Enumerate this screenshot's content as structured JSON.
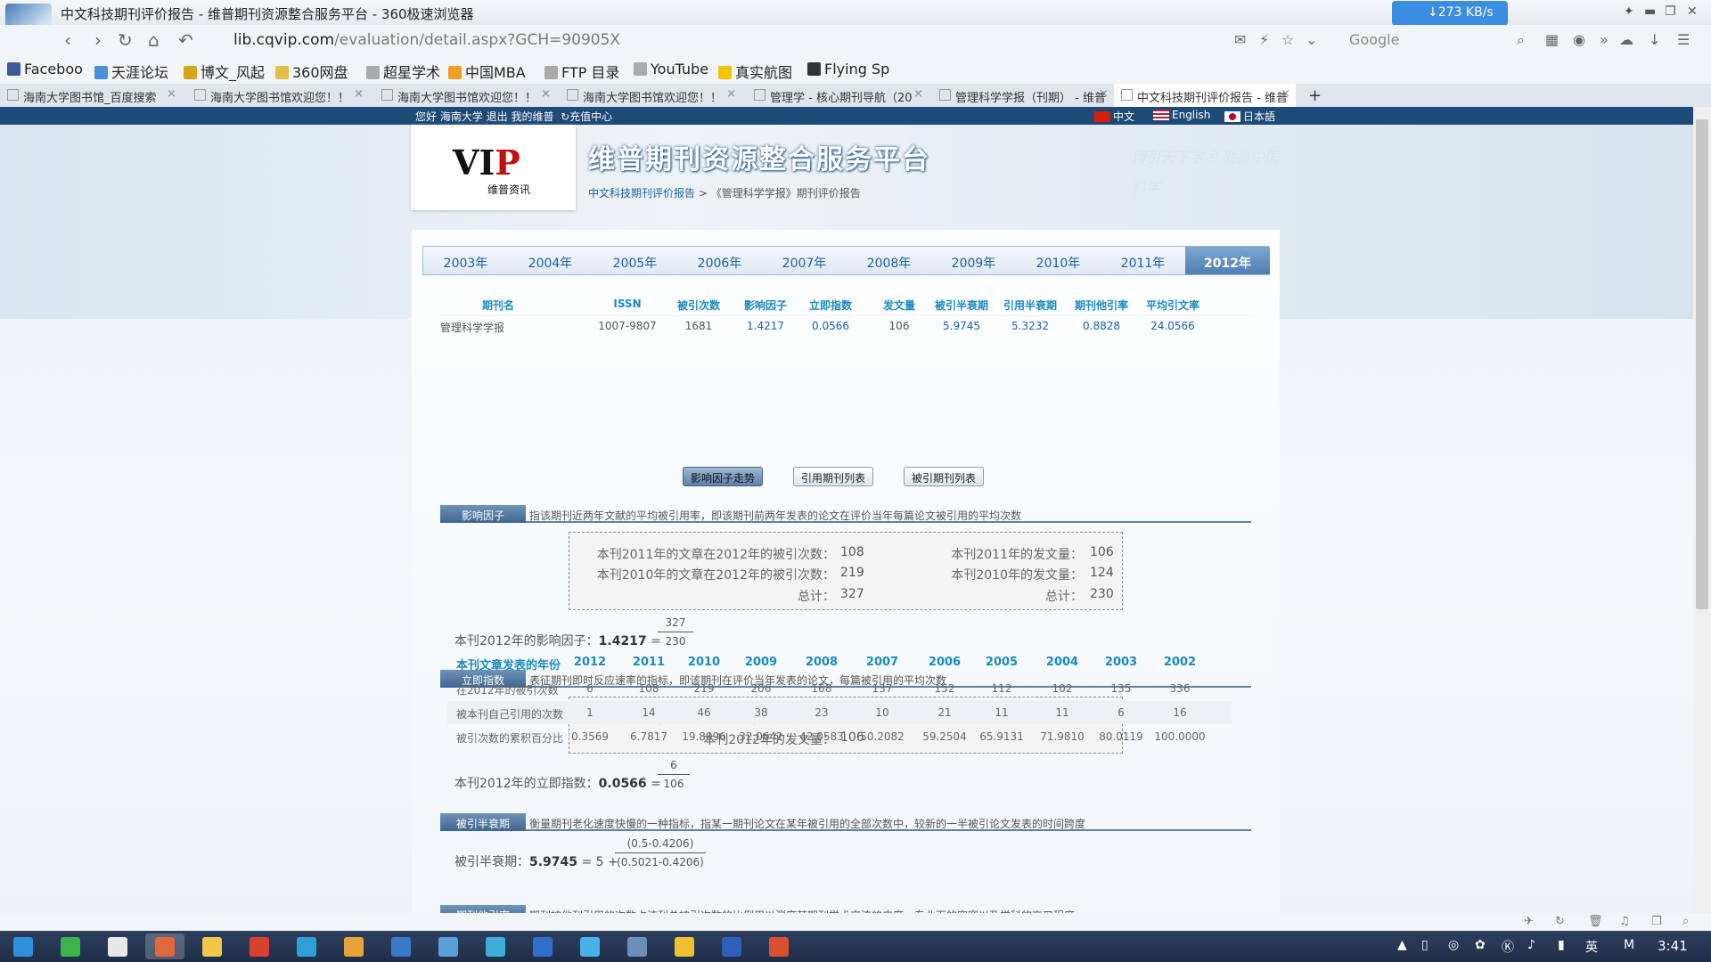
{
  "browser": {
    "window_title": "中文科技期刊评价报告 - 维普期刊资源整合服务平台 - 360极速浏览器",
    "speed": "↓273 KB/s",
    "url_host": "lib.cqvip.com",
    "url_path": "/evaluation/detail.aspx?GCH=90905X",
    "search_placeholder": "Google",
    "bookmarks": [
      {
        "label": "Faceboo",
        "color": "#3b5998"
      },
      {
        "label": "天涯论坛",
        "color": "#4a90d9"
      },
      {
        "label": "博文_风起",
        "color": "#d7a51a"
      },
      {
        "label": "360网盘",
        "color": "#e0c04a"
      },
      {
        "label": "超星学术",
        "color": "#aaaaaa"
      },
      {
        "label": "中国MBA",
        "color": "#f0a020"
      },
      {
        "label": "FTP 目录",
        "color": "#aaaaaa"
      },
      {
        "label": "YouTube",
        "color": "#aaaaaa"
      },
      {
        "label": "真实航图",
        "color": "#f5c400"
      },
      {
        "label": "Flying Sp",
        "color": "#333333"
      }
    ],
    "tabs": [
      {
        "label": "海南大学图书馆_百度搜索"
      },
      {
        "label": "海南大学图书馆欢迎您！！"
      },
      {
        "label": "海南大学图书馆欢迎您！！"
      },
      {
        "label": "海南大学图书馆欢迎您！！"
      },
      {
        "label": "管理学 - 核心期刊导航（20"
      },
      {
        "label": "管理科学学报（刊期） - 维普"
      },
      {
        "label": "中文科技期刊评价报告 - 维普"
      }
    ],
    "new_tab": "+"
  },
  "site": {
    "greeting": "您好 海南大学 退出 我的维普",
    "recharge": "充值中心",
    "lang_cn": "中文",
    "lang_en": "English",
    "lang_jp": "日本語",
    "logo_text": "VIP",
    "logo_sub": "维普资讯",
    "title": "维普期刊资源整合服务平台",
    "slogan": "博引天下学术 助推中国科学",
    "breadcrumb_link": "中文科技期刊评价报告",
    "breadcrumb_sep": ">",
    "breadcrumb_current": "《管理科学学报》期刊评价报告"
  },
  "years": [
    "2003年",
    "2004年",
    "2005年",
    "2006年",
    "2007年",
    "2008年",
    "2009年",
    "2010年",
    "2011年",
    "2012年"
  ],
  "active_year": "2012年",
  "journal_table": {
    "headers": [
      "期刊名",
      "ISSN",
      "被引次数",
      "影响因子",
      "立即指数",
      "发文量",
      "被引半衰期",
      "引用半衰期",
      "期刊他引率",
      "平均引文率"
    ],
    "row": [
      "管理科学学报",
      "1007-9807",
      "1681",
      "1.4217",
      "0.0566",
      "106",
      "5.9745",
      "5.3232",
      "0.8828",
      "24.0566"
    ]
  },
  "buttons": {
    "if_trend": "影响因子走势",
    "citing_list": "引用期刊列表",
    "cited_list": "被引期刊列表"
  },
  "impact_factor": {
    "tag": "影响因子",
    "desc": "指该期刊近两年文献的平均被引用率，即该期刊前两年发表的论文在评价当年每篇论文被引用的平均次数",
    "left_labels": [
      "本刊2011年的文章在2012年的被引次数：",
      "本刊2010年的文章在2012年的被引次数：",
      "总计："
    ],
    "left_values": [
      "108",
      "219",
      "327"
    ],
    "right_labels": [
      "本刊2011年的发文量：",
      "本刊2010年的发文量：",
      "总计："
    ],
    "right_values": [
      "106",
      "124",
      "230"
    ],
    "formula_label": "本刊2012年的影响因子：",
    "formula_value": "1.4217",
    "eq": "=",
    "numerator": "327",
    "denominator": "230"
  },
  "immediacy": {
    "tag": "立即指数",
    "desc": "表征期刊即时反应速率的指标，即该期刊在评价当年发表的论文，每篇被引用的平均次数",
    "labels": [
      "本刊2012年的文章在2012年的被引次数：",
      "本刊2012年的发文量："
    ],
    "values": [
      "6",
      "106"
    ],
    "formula_label": "本刊2012年的立即指数：",
    "formula_value": "0.0566",
    "eq": "=",
    "numerator": "6",
    "denominator": "106"
  },
  "halflife": {
    "tag": "被引半衰期",
    "desc": "衡量期刊老化速度快慢的一种指标，指某一期刊论文在某年被引用的全部次数中，较新的一半被引论文发表的时间跨度",
    "formula_label": "被引半衰期：",
    "formula_value": "5.9745",
    "eq": "= 5 +",
    "numerator": "(0.5-0.4206)",
    "denominator": "(0.5021-0.4206)"
  },
  "halflife_table": {
    "header_label": "本刊文章发表的年份",
    "years": [
      "2012",
      "2011",
      "2010",
      "2009",
      "2008",
      "2007",
      "2006",
      "2005",
      "2004",
      "2003",
      "2002"
    ],
    "rows": [
      {
        "label": "在2012年的被引次数",
        "values": [
          "6",
          "108",
          "219",
          "206",
          "168",
          "137",
          "152",
          "112",
          "102",
          "135",
          "336"
        ]
      },
      {
        "label": "被本刊自己引用的次数",
        "values": [
          "1",
          "14",
          "46",
          "38",
          "23",
          "10",
          "21",
          "11",
          "11",
          "6",
          "16"
        ]
      },
      {
        "label": "被引次数的累积百分比",
        "values": [
          "0.3569",
          "6.7817",
          "19.8096",
          "32.0642",
          "42.0583",
          "50.2082",
          "59.2504",
          "65.9131",
          "71.9810",
          "80.0119",
          "100.0000"
        ]
      }
    ]
  },
  "other_cite": {
    "tag": "期刊他引率",
    "desc": "期刊被他刊引用的次数占该刊总被引次数的比例用以测度某期刊学术交流的广度、专业面的宽窄以及学科的交叉程度"
  },
  "taskbar": {
    "clock": "3:41",
    "ime": "英"
  },
  "colors": {
    "accent": "#1a5fa8",
    "header_bar": "#1e4a78",
    "table_header": "#1a8ac0"
  }
}
